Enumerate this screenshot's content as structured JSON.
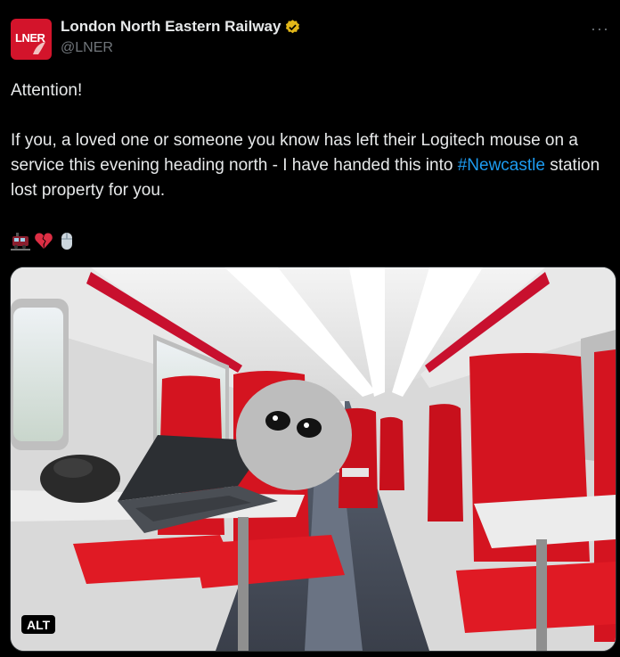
{
  "author": {
    "logo_text": "LNER",
    "display_name": "London North Eastern Railway",
    "handle": "@LNER",
    "verified": true
  },
  "tweet": {
    "line1": "Attention!",
    "line2_before": "If you, a loved one or someone you know has left their Logitech mouse on a service this evening heading north - I have handed this into ",
    "hashtag": "#Newcastle",
    "line2_after": " station lost property for you.",
    "emojis": [
      "train-emoji",
      "broken-heart-emoji",
      "computer-mouse-emoji"
    ]
  },
  "media": {
    "alt_label": "ALT",
    "description_icons": [
      "train-interior",
      "laptop",
      "mouse",
      "cat-meme"
    ]
  },
  "menu": {
    "more_label": "···"
  },
  "colors": {
    "background": "#000000",
    "text": "#e7e9ea",
    "muted": "#71767b",
    "link": "#1d9bf0",
    "brand": "#d3142b",
    "verified": "#e2b719"
  }
}
